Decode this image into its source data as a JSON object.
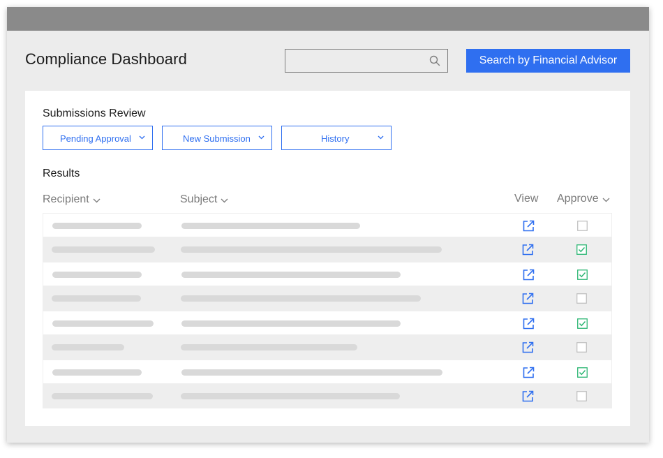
{
  "header": {
    "title": "Compliance Dashboard",
    "search_placeholder": "",
    "search_button_label": "Search by Financial Advisor"
  },
  "submissions": {
    "title": "Submissions Review",
    "filters": [
      {
        "label": "Pending Approval"
      },
      {
        "label": "New Submission"
      },
      {
        "label": "History"
      }
    ]
  },
  "results": {
    "title": "Results",
    "columns": {
      "recipient": "Recipient",
      "subject": "Subject",
      "view": "View",
      "approve": "Approve"
    },
    "rows": [
      {
        "approved": false
      },
      {
        "approved": true
      },
      {
        "approved": true
      },
      {
        "approved": false
      },
      {
        "approved": true
      },
      {
        "approved": false
      },
      {
        "approved": true
      },
      {
        "approved": false
      }
    ]
  },
  "colors": {
    "accent": "#2f6ff0",
    "approved_check": "#2bb673",
    "titlebar": "#8a8a8a",
    "skeleton": "#d9d9d9"
  }
}
